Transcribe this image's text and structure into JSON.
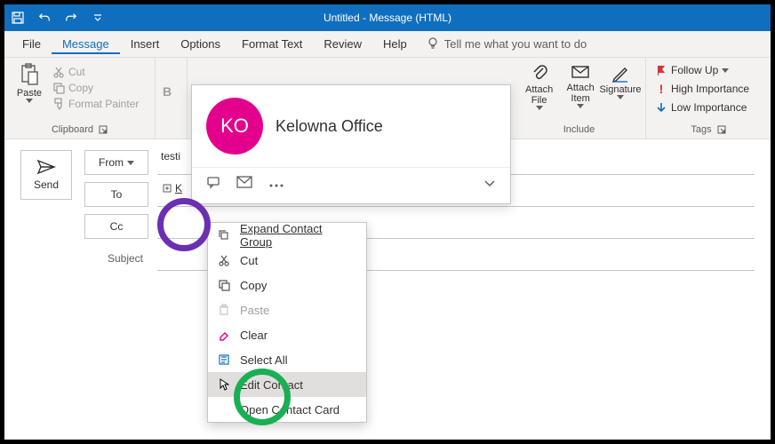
{
  "titlebar": {
    "title": "Untitled  -  Message (HTML)"
  },
  "menubar": {
    "file": "File",
    "message": "Message",
    "insert": "Insert",
    "options": "Options",
    "formattext": "Format Text",
    "review": "Review",
    "help": "Help",
    "tellme": "Tell me what you want to do"
  },
  "ribbon": {
    "clipboard": {
      "label": "Clipboard",
      "paste": "Paste",
      "cut": "Cut",
      "copy": "Copy",
      "formatpainter": "Format Painter"
    },
    "include": {
      "label": "Include",
      "attachfile": "Attach File",
      "attachitem": "Attach Item",
      "signature": "Signature"
    },
    "tags": {
      "label": "Tags",
      "followup": "Follow Up",
      "high": "High Importance",
      "low": "Low Importance"
    }
  },
  "compose": {
    "send": "Send",
    "from": "From",
    "from_value": "testi",
    "to": "To",
    "to_value": "K",
    "cc": "Cc",
    "subject": "Subject"
  },
  "contact_card": {
    "initials": "KO",
    "name": "Kelowna Office"
  },
  "context_menu": {
    "expand": "Expand Contact Group",
    "cut": "Cut",
    "copy": "Copy",
    "paste": "Paste",
    "clear": "Clear",
    "selectall": "Select All",
    "editcontact": "Edit Contact",
    "opencard": "Open Contact Card"
  }
}
